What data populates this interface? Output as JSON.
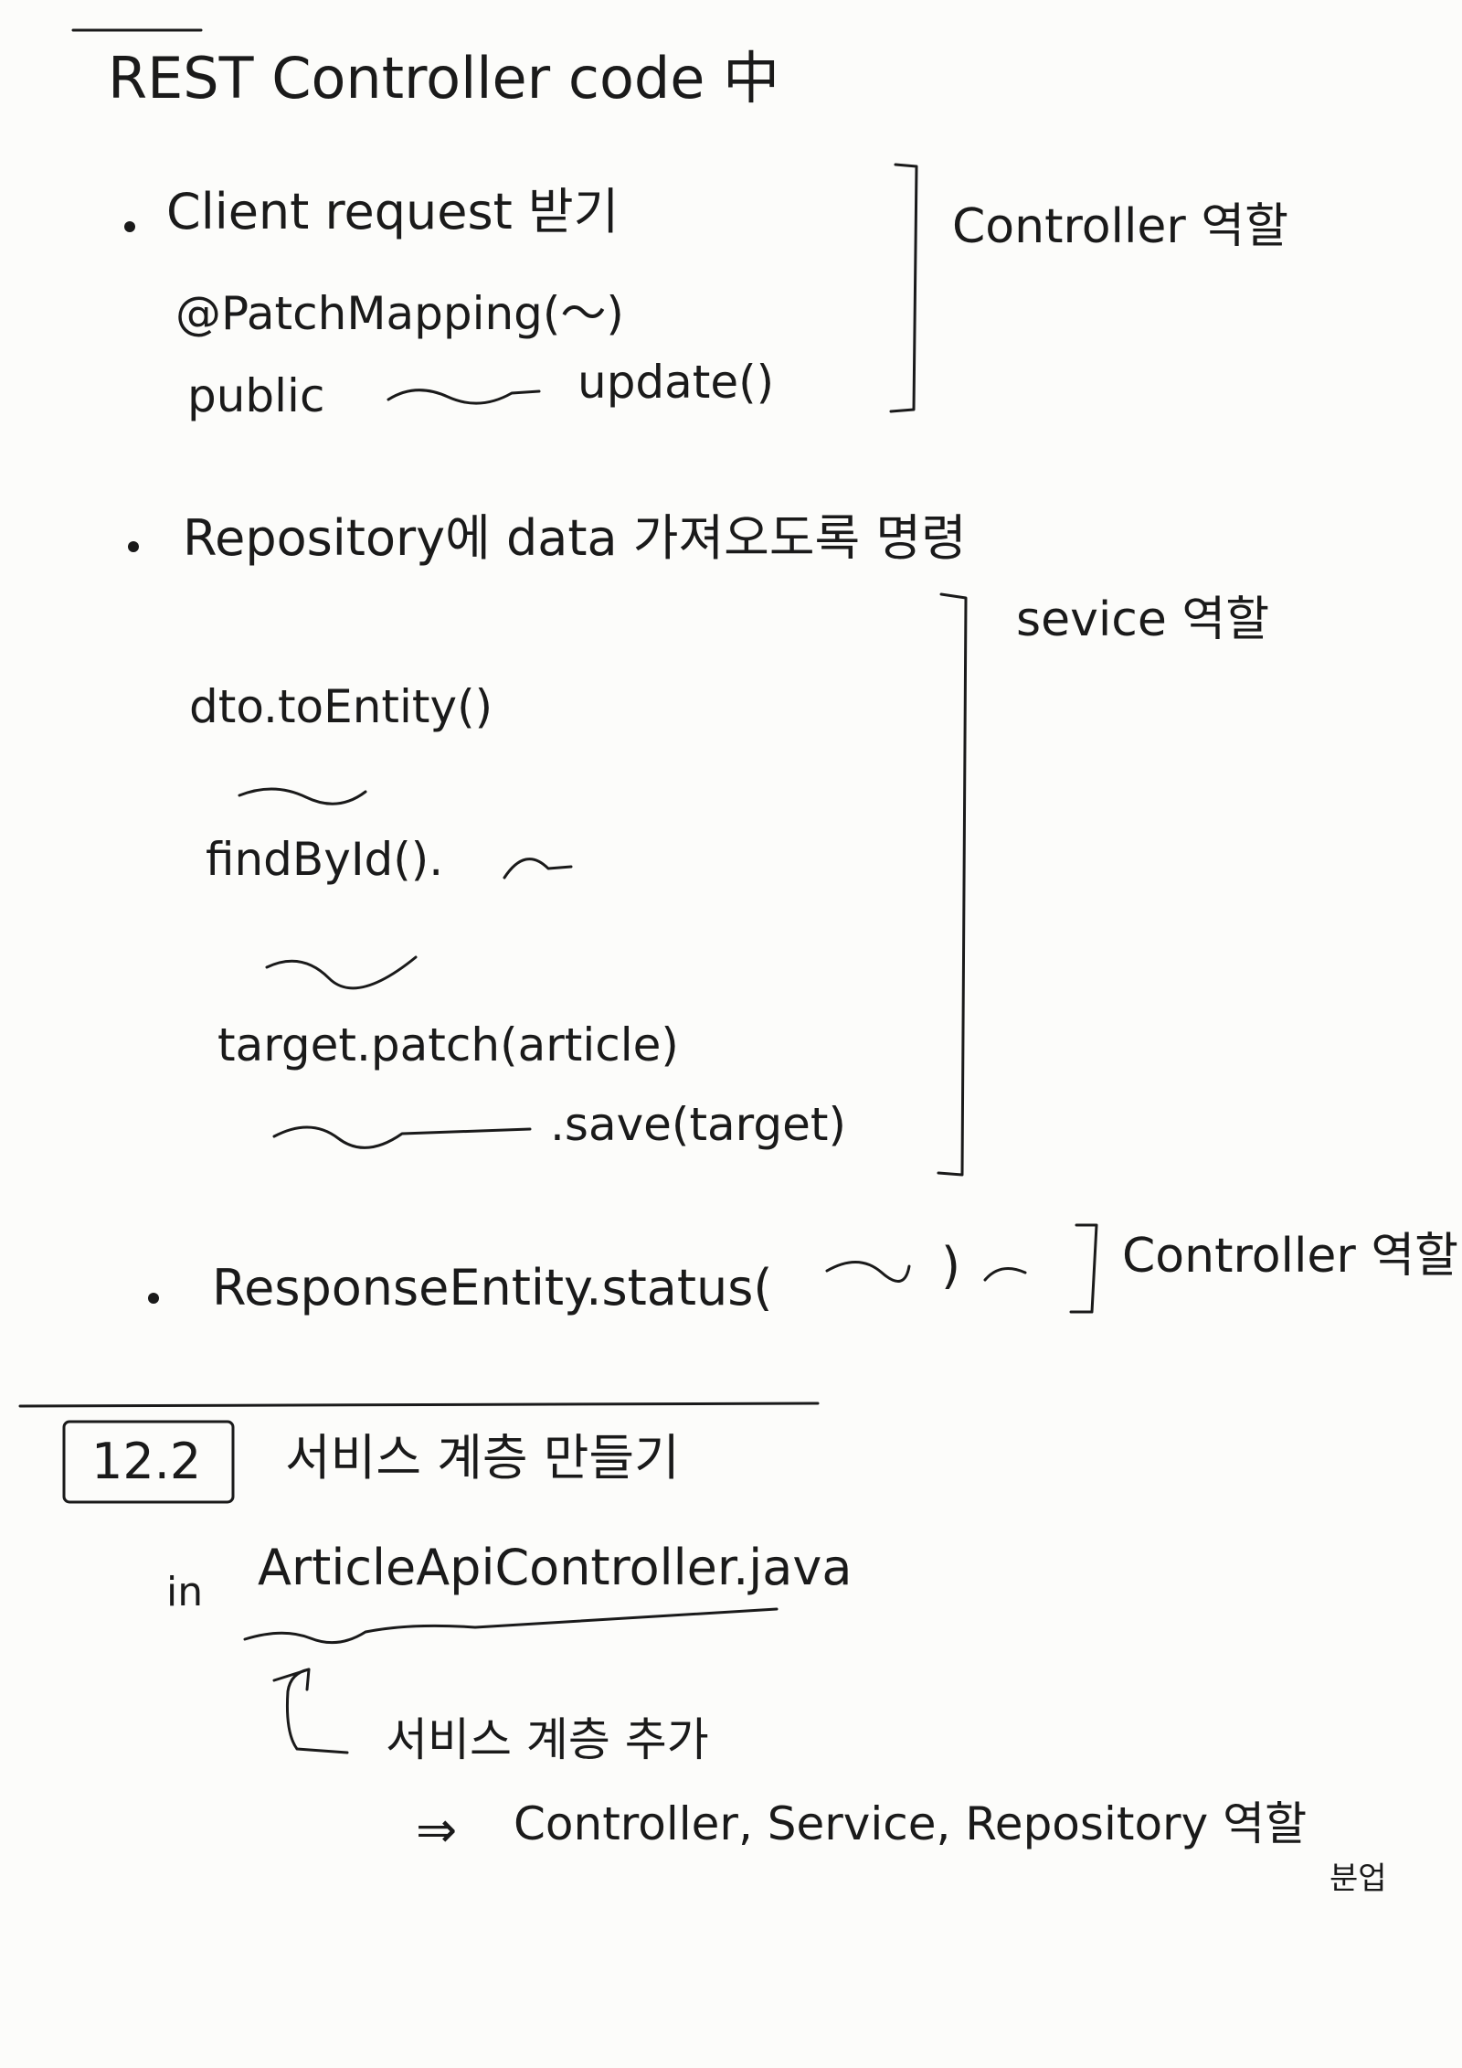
{
  "title": "REST Controller code 中",
  "sections": [
    {
      "bullet_text": "Client request 받기",
      "lines": [
        "@PatchMapping(〜)",
        "public",
        "update()"
      ],
      "role_label": "Controller 역할"
    },
    {
      "bullet_text": "Repository에 data 가져오도록 명령",
      "role_label": "sevice 역할",
      "lines": [
        "dto.toEntity()",
        "findById().",
        "target.patch(article)",
        ".save(target)"
      ]
    },
    {
      "bullet_text": "ResponseEntity.status(",
      "tail": ")",
      "role_label": "Controller 역할"
    }
  ],
  "section_box": "12.2",
  "section_title": "서비스 계층 만들기",
  "in_word": "in",
  "file_name": "ArticleApiController.java",
  "note": "서비스 계층 추가",
  "conclusion_arrow": "⇒",
  "conclusion": "Controller, Service, Repository 역할",
  "conclusion_tail": "분업"
}
